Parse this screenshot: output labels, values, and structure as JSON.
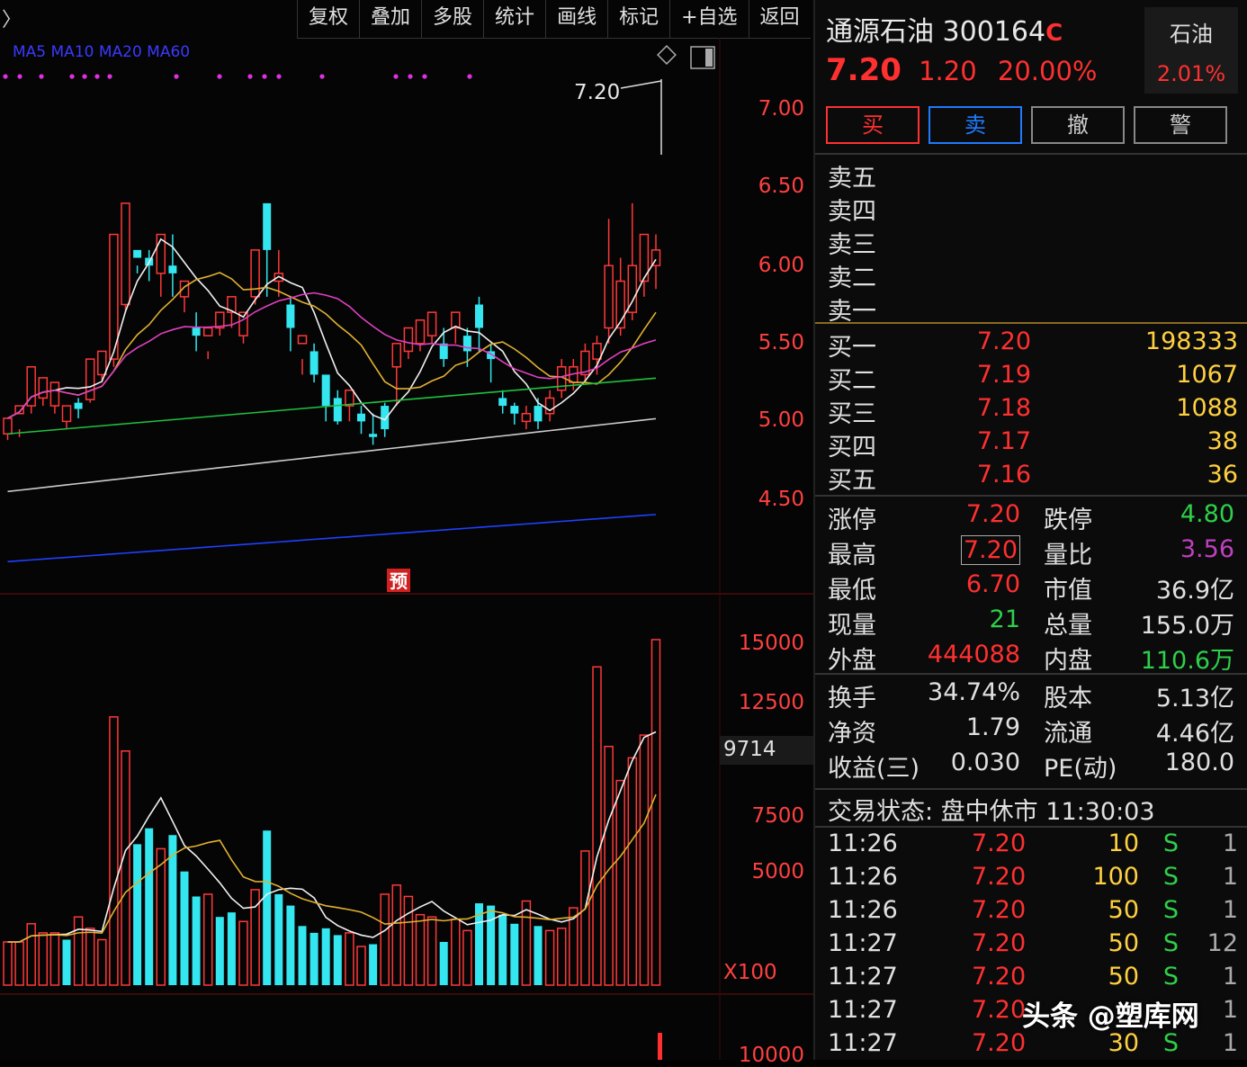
{
  "toolbar": {
    "items": [
      "复权",
      "叠加",
      "多股",
      "统计",
      "画线",
      "标记",
      "+自选",
      "返回"
    ]
  },
  "chart_header": {
    "ma_label": "MA5 MA10 MA20 MA60",
    "top_price_label": "7.20",
    "forecast_badge": "预"
  },
  "price_axis": [
    "7.00",
    "6.50",
    "6.00",
    "5.50",
    "5.00",
    "4.50"
  ],
  "volume_axis": [
    "15000",
    "12500",
    "9714",
    "7500",
    "5000",
    "X100",
    "10000"
  ],
  "stock": {
    "name": "通源石油 300164",
    "tag": "C",
    "price": "7.20",
    "change": "1.20",
    "change_pct": "20.00%",
    "sector": "石油",
    "sector_pct": "2.01%"
  },
  "actions": [
    "买",
    "卖",
    "撤",
    "警"
  ],
  "sell_book": [
    {
      "label": "卖五",
      "price": "",
      "vol": ""
    },
    {
      "label": "卖四",
      "price": "",
      "vol": ""
    },
    {
      "label": "卖三",
      "price": "",
      "vol": ""
    },
    {
      "label": "卖二",
      "price": "",
      "vol": ""
    },
    {
      "label": "卖一",
      "price": "",
      "vol": ""
    }
  ],
  "buy_book": [
    {
      "label": "买一",
      "price": "7.20",
      "vol": "198333"
    },
    {
      "label": "买二",
      "price": "7.19",
      "vol": "1067"
    },
    {
      "label": "买三",
      "price": "7.18",
      "vol": "1088"
    },
    {
      "label": "买四",
      "price": "7.17",
      "vol": "38"
    },
    {
      "label": "买五",
      "price": "7.16",
      "vol": "36"
    }
  ],
  "stats_a": [
    {
      "l1": "涨停",
      "v1": "7.20",
      "c1": "#ff3030",
      "l2": "跌停",
      "v2": "4.80",
      "c2": "#2ecf4a"
    },
    {
      "l1": "最高",
      "v1": "7.20",
      "c1": "#ff3030",
      "l2": "量比",
      "v2": "3.56",
      "c2": "#c040c0"
    },
    {
      "l1": "最低",
      "v1": "6.70",
      "c1": "#ff3030",
      "l2": "市值",
      "v2": "36.9亿",
      "c2": "#e0e0e0"
    },
    {
      "l1": "现量",
      "v1": "21",
      "c1": "#2ecf4a",
      "l2": "总量",
      "v2": "155.0万",
      "c2": "#e0e0e0"
    },
    {
      "l1": "外盘",
      "v1": "444088",
      "c1": "#ff3030",
      "l2": "内盘",
      "v2": "110.6万",
      "c2": "#2ecf4a"
    }
  ],
  "stats_b": [
    {
      "l1": "换手",
      "v1": "34.74%",
      "l2": "股本",
      "v2": "5.13亿"
    },
    {
      "l1": "净资",
      "v1": "1.79",
      "l2": "流通",
      "v2": "4.46亿"
    },
    {
      "l1": "收益(三)",
      "v1": "0.030",
      "l2": "PE(动)",
      "v2": "180.0"
    }
  ],
  "status": "交易状态: 盘中休市 11:30:03",
  "trades": [
    {
      "time": "11:26",
      "price": "7.20",
      "vol": "10",
      "side": "S",
      "n": "1"
    },
    {
      "time": "11:26",
      "price": "7.20",
      "vol": "100",
      "side": "S",
      "n": "1"
    },
    {
      "time": "11:26",
      "price": "7.20",
      "vol": "50",
      "side": "S",
      "n": "1"
    },
    {
      "time": "11:27",
      "price": "7.20",
      "vol": "50",
      "side": "S",
      "n": "12"
    },
    {
      "time": "11:27",
      "price": "7.20",
      "vol": "50",
      "side": "S",
      "n": "1"
    },
    {
      "time": "11:27",
      "price": "7.20",
      "vol": "",
      "side": "",
      "n": "1"
    },
    {
      "time": "11:27",
      "price": "7.20",
      "vol": "30",
      "side": "S",
      "n": "1"
    }
  ],
  "watermark": "头条 @塑库网",
  "chart_data": {
    "type": "candlestick",
    "ylim": [
      4.3,
      7.3
    ],
    "vol_ylim": [
      0,
      16500
    ],
    "candles": [
      [
        4.92,
        5.02,
        4.88,
        5.0
      ],
      [
        5.05,
        5.1,
        4.9,
        4.95
      ],
      [
        5.1,
        5.35,
        5.05,
        5.3
      ],
      [
        5.15,
        5.28,
        5.1,
        5.25
      ],
      [
        5.1,
        5.25,
        5.05,
        5.2
      ],
      [
        5.0,
        5.1,
        4.95,
        5.02
      ],
      [
        5.12,
        5.08,
        5.02,
        5.15
      ],
      [
        5.14,
        5.4,
        5.12,
        5.35
      ],
      [
        5.3,
        5.45,
        5.25,
        5.42
      ],
      [
        5.4,
        6.2,
        5.35,
        5.75
      ],
      [
        5.75,
        6.4,
        5.7,
        6.0
      ],
      [
        6.1,
        6.05,
        5.95,
        6.0
      ],
      [
        6.05,
        6.0,
        5.9,
        6.1
      ],
      [
        5.95,
        6.2,
        5.8,
        6.0
      ],
      [
        6.0,
        5.95,
        5.8,
        6.2
      ],
      [
        5.8,
        5.9,
        5.7,
        5.85
      ],
      [
        5.6,
        5.55,
        5.45,
        5.7
      ],
      [
        5.55,
        5.6,
        5.4,
        5.45
      ],
      [
        5.6,
        5.7,
        5.55,
        5.65
      ],
      [
        5.7,
        5.8,
        5.6,
        5.75
      ],
      [
        5.55,
        5.7,
        5.5,
        5.65
      ],
      [
        5.8,
        6.1,
        5.75,
        6.0
      ],
      [
        6.4,
        6.1,
        5.8,
        6.4
      ],
      [
        5.9,
        5.95,
        5.8,
        6.1
      ],
      [
        5.75,
        5.6,
        5.45,
        5.8
      ],
      [
        5.5,
        5.55,
        5.3,
        5.4
      ],
      [
        5.45,
        5.3,
        5.25,
        5.5
      ],
      [
        5.3,
        5.1,
        5.0,
        5.3
      ],
      [
        5.15,
        5.0,
        4.98,
        5.2
      ],
      [
        5.1,
        5.2,
        5.0,
        5.15
      ],
      [
        5.05,
        5.0,
        4.92,
        5.1
      ],
      [
        4.92,
        4.9,
        4.85,
        5.05
      ],
      [
        5.1,
        4.95,
        4.9,
        5.12
      ],
      [
        5.35,
        5.5,
        5.1,
        5.45
      ],
      [
        5.45,
        5.6,
        5.4,
        5.55
      ],
      [
        5.5,
        5.65,
        5.45,
        5.6
      ],
      [
        5.55,
        5.7,
        5.5,
        5.65
      ],
      [
        5.5,
        5.4,
        5.35,
        5.6
      ],
      [
        5.6,
        5.7,
        5.5,
        5.65
      ],
      [
        5.55,
        5.45,
        5.35,
        5.6
      ],
      [
        5.75,
        5.6,
        5.45,
        5.8
      ],
      [
        5.45,
        5.4,
        5.25,
        5.5
      ],
      [
        5.15,
        5.1,
        5.05,
        5.2
      ],
      [
        5.1,
        5.05,
        4.98,
        5.12
      ],
      [
        5.0,
        5.05,
        4.95,
        5.1
      ],
      [
        5.1,
        5.0,
        4.95,
        5.15
      ],
      [
        5.05,
        5.15,
        5.0,
        5.2
      ],
      [
        5.2,
        5.35,
        5.15,
        5.4
      ],
      [
        5.25,
        5.35,
        5.2,
        5.4
      ],
      [
        5.3,
        5.45,
        5.25,
        5.5
      ],
      [
        5.4,
        5.5,
        5.3,
        5.55
      ],
      [
        5.6,
        6.0,
        5.5,
        6.3
      ],
      [
        5.6,
        5.9,
        5.55,
        6.05
      ],
      [
        5.7,
        6.0,
        5.65,
        6.4
      ],
      [
        5.9,
        6.2,
        5.8,
        6.1
      ],
      [
        6.0,
        6.1,
        5.85,
        6.2
      ]
    ],
    "volumes": [
      [
        1900,
        1
      ],
      [
        1900,
        1
      ],
      [
        2700,
        1
      ],
      [
        2300,
        1
      ],
      [
        2300,
        1
      ],
      [
        2000,
        0
      ],
      [
        3000,
        1
      ],
      [
        2500,
        1
      ],
      [
        2000,
        1
      ],
      [
        11800,
        1
      ],
      [
        10300,
        1
      ],
      [
        6200,
        0
      ],
      [
        6900,
        0
      ],
      [
        6000,
        1
      ],
      [
        6600,
        0
      ],
      [
        5000,
        0
      ],
      [
        3900,
        0
      ],
      [
        4000,
        1
      ],
      [
        3000,
        0
      ],
      [
        3200,
        0
      ],
      [
        2800,
        1
      ],
      [
        4200,
        1
      ],
      [
        6800,
        0
      ],
      [
        4000,
        0
      ],
      [
        3500,
        0
      ],
      [
        2600,
        0
      ],
      [
        2300,
        0
      ],
      [
        2500,
        0
      ],
      [
        2200,
        0
      ],
      [
        2300,
        1
      ],
      [
        1700,
        1
      ],
      [
        1800,
        0
      ],
      [
        4000,
        1
      ],
      [
        4400,
        1
      ],
      [
        3900,
        1
      ],
      [
        3100,
        1
      ],
      [
        3000,
        1
      ],
      [
        1900,
        0
      ],
      [
        2900,
        1
      ],
      [
        2400,
        1
      ],
      [
        3600,
        0
      ],
      [
        3500,
        0
      ],
      [
        3100,
        0
      ],
      [
        2700,
        0
      ],
      [
        3700,
        1
      ],
      [
        2600,
        0
      ],
      [
        2400,
        1
      ],
      [
        2500,
        1
      ],
      [
        3400,
        1
      ],
      [
        5900,
        1
      ],
      [
        14000,
        1
      ],
      [
        10500,
        1
      ],
      [
        9000,
        1
      ],
      [
        10000,
        1
      ],
      [
        11000,
        1
      ],
      [
        15200,
        1
      ]
    ]
  }
}
